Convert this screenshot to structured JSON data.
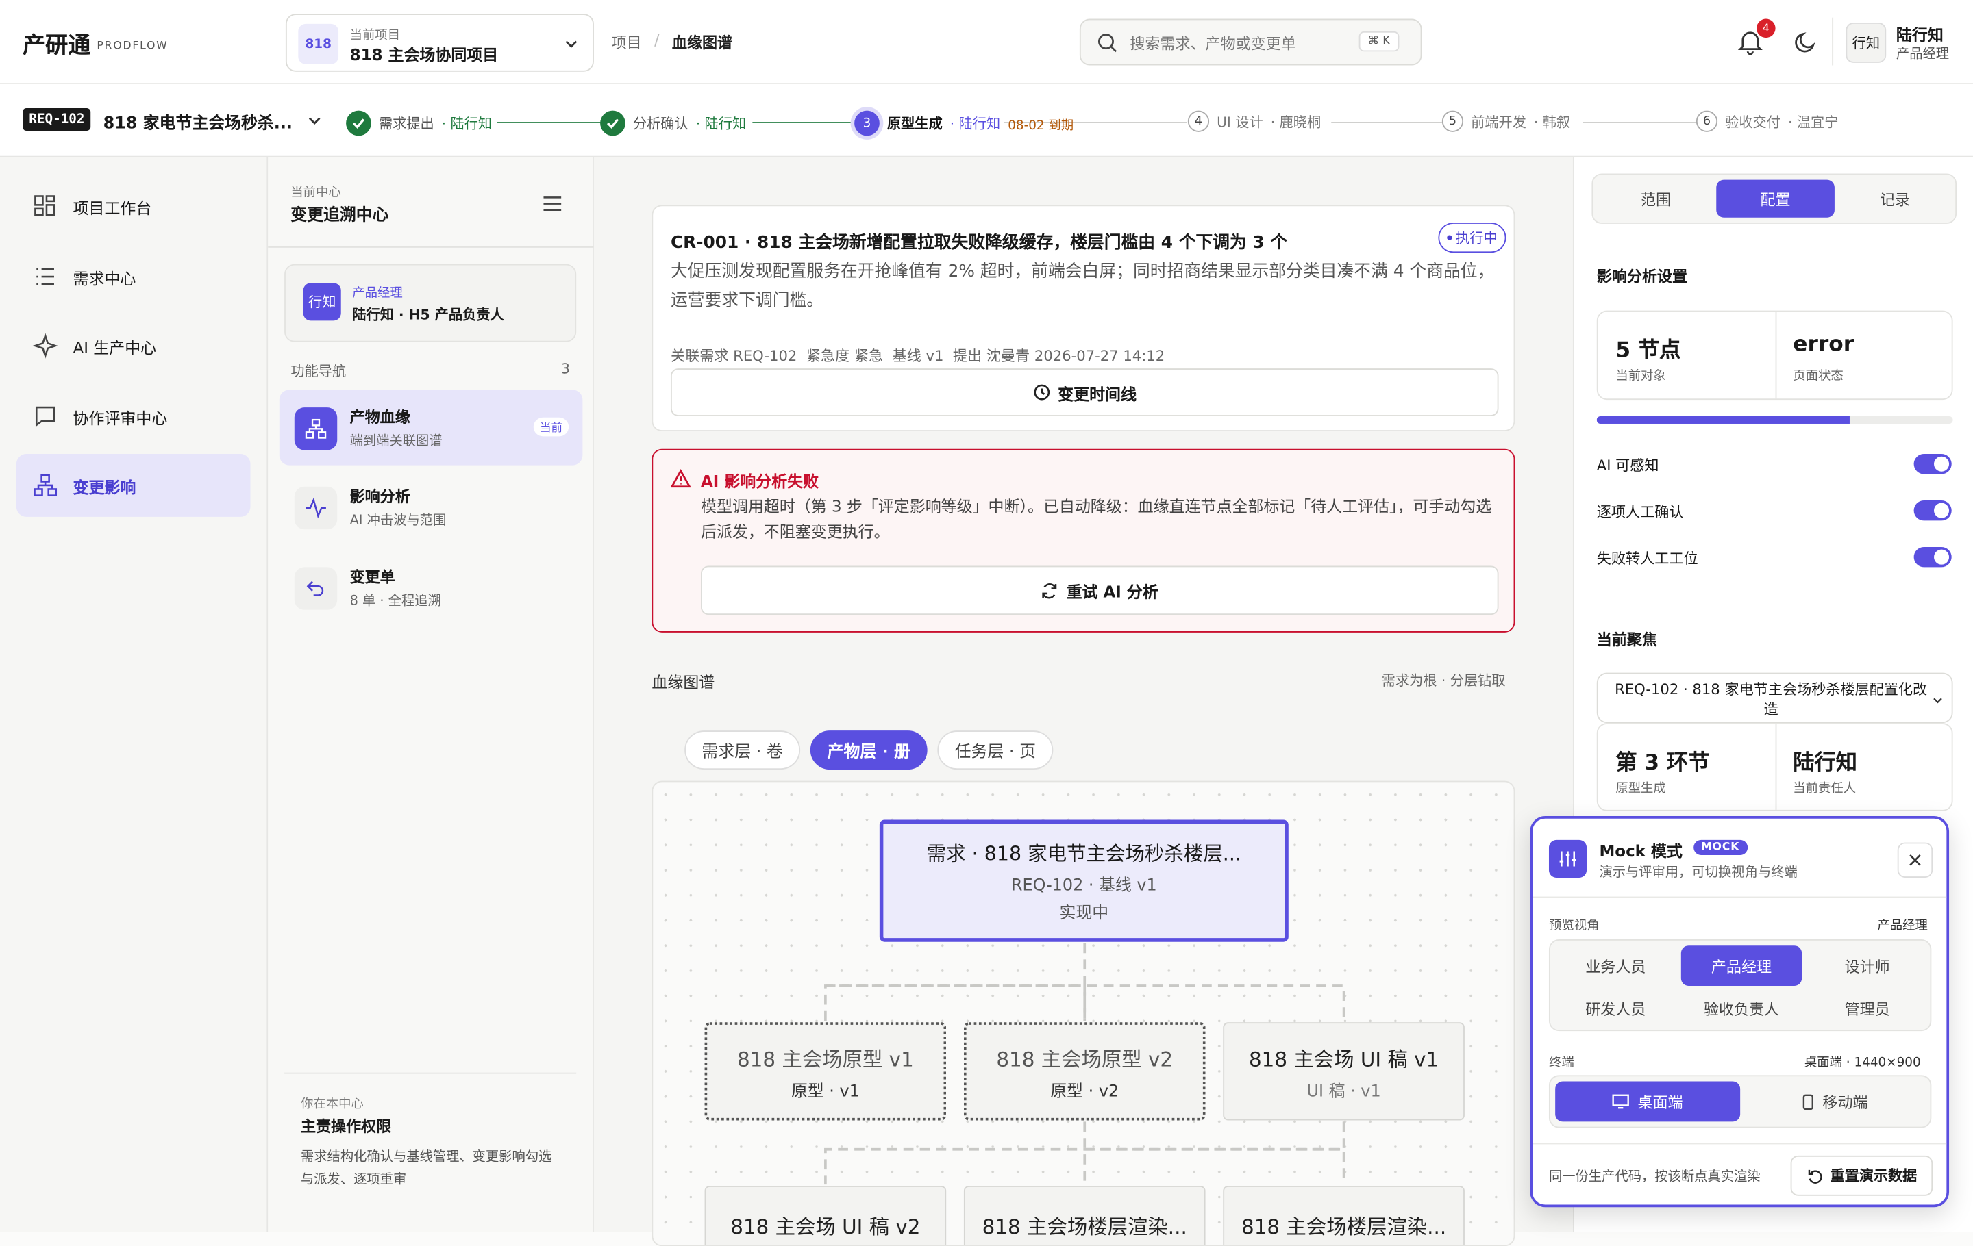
{
  "app": {
    "name": "产研通",
    "sub": "PRODFLOW"
  },
  "project": {
    "badge": "818",
    "caption": "当前项目",
    "name": "818 主会场协同项目"
  },
  "breadcrumb": {
    "item1": "项目",
    "sep": "/",
    "current": "血缘图谱"
  },
  "search": {
    "placeholder": "搜索需求、产物或变更单",
    "shortcut": "⌘ K"
  },
  "notifications": {
    "count": "4"
  },
  "user": {
    "avatar": "行知",
    "name": "陆行知",
    "role": "产品经理"
  },
  "requirement": {
    "tag": "REQ-102",
    "title": "818 家电节主会场秒杀..."
  },
  "steps": [
    {
      "num": "1",
      "label": "需求提出",
      "owner": "· 陆行知",
      "state": "done"
    },
    {
      "num": "2",
      "label": "分析确认",
      "owner": "· 陆行知",
      "state": "done"
    },
    {
      "num": "3",
      "label": "原型生成",
      "owner": "· 陆行知",
      "due": "08-02 到期",
      "state": "current"
    },
    {
      "num": "4",
      "label": "UI 设计",
      "owner": "· 鹿晓桐",
      "state": "todo"
    },
    {
      "num": "5",
      "label": "前端开发",
      "owner": "· 韩叙",
      "state": "todo"
    },
    {
      "num": "6",
      "label": "验收交付",
      "owner": "· 温宜宁",
      "state": "todo"
    }
  ],
  "sidebar": {
    "items": [
      {
        "label": "项目工作台",
        "icon": "grid-icon"
      },
      {
        "label": "需求中心",
        "icon": "list-icon"
      },
      {
        "label": "AI 生产中心",
        "icon": "sparkle-icon"
      },
      {
        "label": "协作评审中心",
        "icon": "chat-icon"
      },
      {
        "label": "变更影响",
        "icon": "hierarchy-icon",
        "active": true
      }
    ]
  },
  "subnav": {
    "caption": "当前中心",
    "title": "变更追溯中心",
    "profile": {
      "avatar": "行知",
      "role": "产品经理",
      "name": "陆行知 · H5 产品负责人"
    },
    "section": "功能导航",
    "count": "3",
    "items": [
      {
        "title": "产物血缘",
        "desc": "端到端关联图谱",
        "badge": "当前"
      },
      {
        "title": "影响分析",
        "desc": "AI 冲击波与范围"
      },
      {
        "title": "变更单",
        "desc": "8 单 · 全程追溯"
      }
    ],
    "footer": {
      "caption": "你在本中心",
      "title": "主责操作权限",
      "desc": "需求结构化确认与基线管理、变更影响勾选与派发、逐项重审"
    }
  },
  "cr": {
    "title": "CR-001 · 818 主会场新增配置拉取失败降级缓存，楼层门槛由 4 个下调为 3 个",
    "status": "执行中",
    "desc": "大促压测发现配置服务在开抢峰值有 2% 超时，前端会白屏；同时招商结果显示部分类目凑不满 4 个商品位，运营要求下调门槛。",
    "meta": "关联需求 REQ-102  紧急度 紧急  基线 v1  提出 沈曼青 2026-07-27 14:12",
    "timeline_btn": "变更时间线"
  },
  "alert": {
    "title": "AI 影响分析失败",
    "desc": "模型调用超时（第 3 步「评定影响等级」中断）。已自动降级：血缘直连节点全部标记「待人工评估」，可手动勾选后派发，不阻塞变更执行。",
    "retry": "重试 AI 分析"
  },
  "lineage": {
    "title": "血缘图谱",
    "hint": "需求为根 · 分层钻取",
    "tabs": [
      "需求层 · 卷",
      "产物层 · 册",
      "任务层 · 页"
    ],
    "root": {
      "title": "需求 · 818 家电节主会场秒杀楼层...",
      "sub": "REQ-102 · 基线 v1",
      "state": "实现中"
    },
    "nodes": [
      {
        "title": "818 主会场原型 v1",
        "sub": "原型 · v1"
      },
      {
        "title": "818 主会场原型 v2",
        "sub": "原型 · v2"
      },
      {
        "title": "818 主会场 UI 稿 v1",
        "sub": "UI 稿 · v1"
      },
      {
        "title": "818 主会场 UI 稿 v2",
        "sub": ""
      },
      {
        "title": "818 主会场楼层渲染...",
        "sub": ""
      },
      {
        "title": "818 主会场楼层渲染...",
        "sub": ""
      }
    ]
  },
  "right": {
    "tabs": [
      "范围",
      "配置",
      "记录"
    ],
    "settings_title": "影响分析设置",
    "stat1": {
      "value": "5 节点",
      "label": "当前对象"
    },
    "stat2": {
      "value": "error",
      "label": "页面状态"
    },
    "progress": 0.71,
    "toggles": [
      "AI 可感知",
      "逐项人工确认",
      "失败转人工工位"
    ],
    "focus_title": "当前聚焦",
    "focus_select": "REQ-102 · 818 家电节主会场秒杀楼层配置化改造",
    "stat3": {
      "value": "第 3 环节",
      "label": "原型生成"
    },
    "stat4": {
      "value": "陆行知",
      "label": "当前责任人"
    }
  },
  "mock": {
    "title": "Mock 模式",
    "badge": "MOCK",
    "desc": "演示与评审用，可切换视角与终端",
    "view_label": "预览视角",
    "view_value": "产品经理",
    "roles": [
      "业务人员",
      "产品经理",
      "设计师",
      "研发人员",
      "验收负责人",
      "管理员"
    ],
    "terminal_label": "终端",
    "terminal_value": "桌面端 · 1440×900",
    "terminals": [
      "桌面端",
      "移动端"
    ],
    "footer": "同一份生产代码，按该断点真实渲染",
    "reset": "重置演示数据"
  },
  "colors": {
    "accent": "#5a4fe0",
    "success": "#1f7a3e",
    "danger": "#c8102e"
  }
}
